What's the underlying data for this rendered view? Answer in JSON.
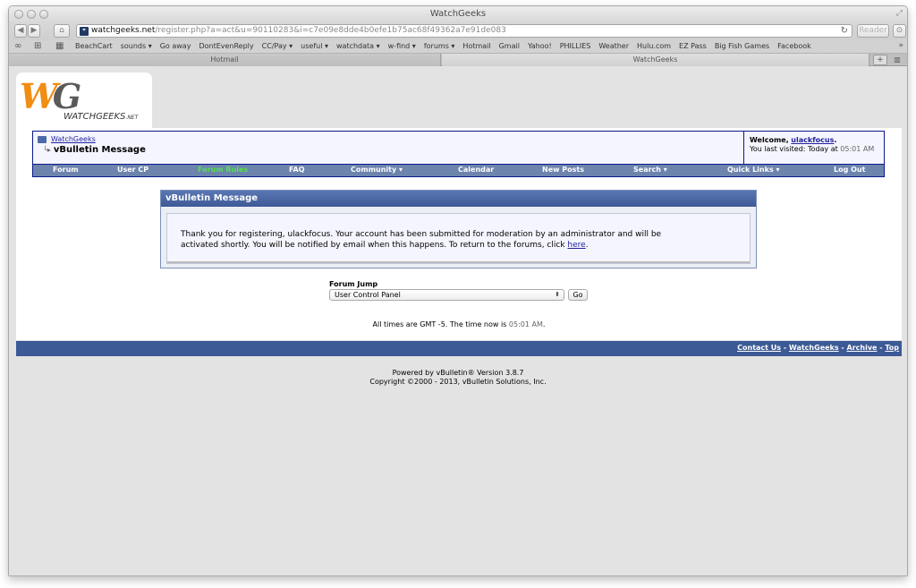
{
  "browser": {
    "window_title": "WatchGeeks",
    "url_host": "watchgeeks.net",
    "url_path": "/register.php?a=act&u=90110283&i=c7e09e8dde4b0efe1b75ac68f49362a7e91de083",
    "reader_label": "Reader",
    "bookmarks": [
      "BeachCart",
      "sounds ▾",
      "Go away",
      "DontEvenReply",
      "CC/Pay ▾",
      "useful ▾",
      "watchdata ▾",
      "w-find ▾",
      "forums ▾",
      "Hotmail",
      "Gmail",
      "Yahoo!",
      "PHILLIES",
      "Weather",
      "Hulu.com",
      "EZ Pass",
      "Big Fish Games",
      "Facebook"
    ],
    "tabs": [
      {
        "label": "Hotmail",
        "active": false
      },
      {
        "label": "WatchGeeks",
        "active": true
      }
    ]
  },
  "logo": {
    "mark_w": "W",
    "mark_g": "G",
    "name": "WATCHGEEKS",
    "suffix": ".NET"
  },
  "breadcrumb": {
    "parent": "WatchGeeks",
    "current": "vBulletin Message"
  },
  "welcome": {
    "prefix": "Welcome,",
    "username": "ulackfocus",
    "period": ".",
    "last_visited": "You last visited: Today at",
    "time": "05:01 AM"
  },
  "navbar": [
    {
      "label": "Forum",
      "active": false
    },
    {
      "label": "User CP",
      "active": false
    },
    {
      "label": "Forum Rules",
      "active": true
    },
    {
      "label": "FAQ",
      "active": false
    },
    {
      "label": "Community ▾",
      "active": false
    },
    {
      "label": "Calendar",
      "active": false
    },
    {
      "label": "New Posts",
      "active": false
    },
    {
      "label": "Search ▾",
      "active": false
    },
    {
      "label": "Quick Links ▾",
      "active": false
    },
    {
      "label": "Log Out",
      "active": false
    }
  ],
  "message": {
    "title": "vBulletin Message",
    "line1": "Thank you for registering, ulackfocus. Your account has been submitted for moderation by an administrator and will be",
    "line2": "activated shortly. You will be notified by email when this happens. To return to the forums, click",
    "link": "here",
    "end": "."
  },
  "forum_jump": {
    "label": "Forum Jump",
    "selected": "User Control Panel",
    "go_label": "Go"
  },
  "gmt": {
    "text": "All times are GMT -5. The time now is",
    "time": "05:01 AM",
    "end": "."
  },
  "footer": {
    "links": [
      "Contact Us",
      "WatchGeeks",
      "Archive",
      "Top"
    ],
    "separator": " - "
  },
  "powered": {
    "line1": "Powered by vBulletin® Version 3.8.7",
    "line2": "Copyright ©2000 - 2013, vBulletin Solutions, Inc."
  },
  "colors": {
    "nav_blue": "#6d84ad",
    "header_blue": "#3e5a96",
    "active_nav": "#56e051",
    "link": "#22229c",
    "logo_orange": "#f08d12"
  }
}
